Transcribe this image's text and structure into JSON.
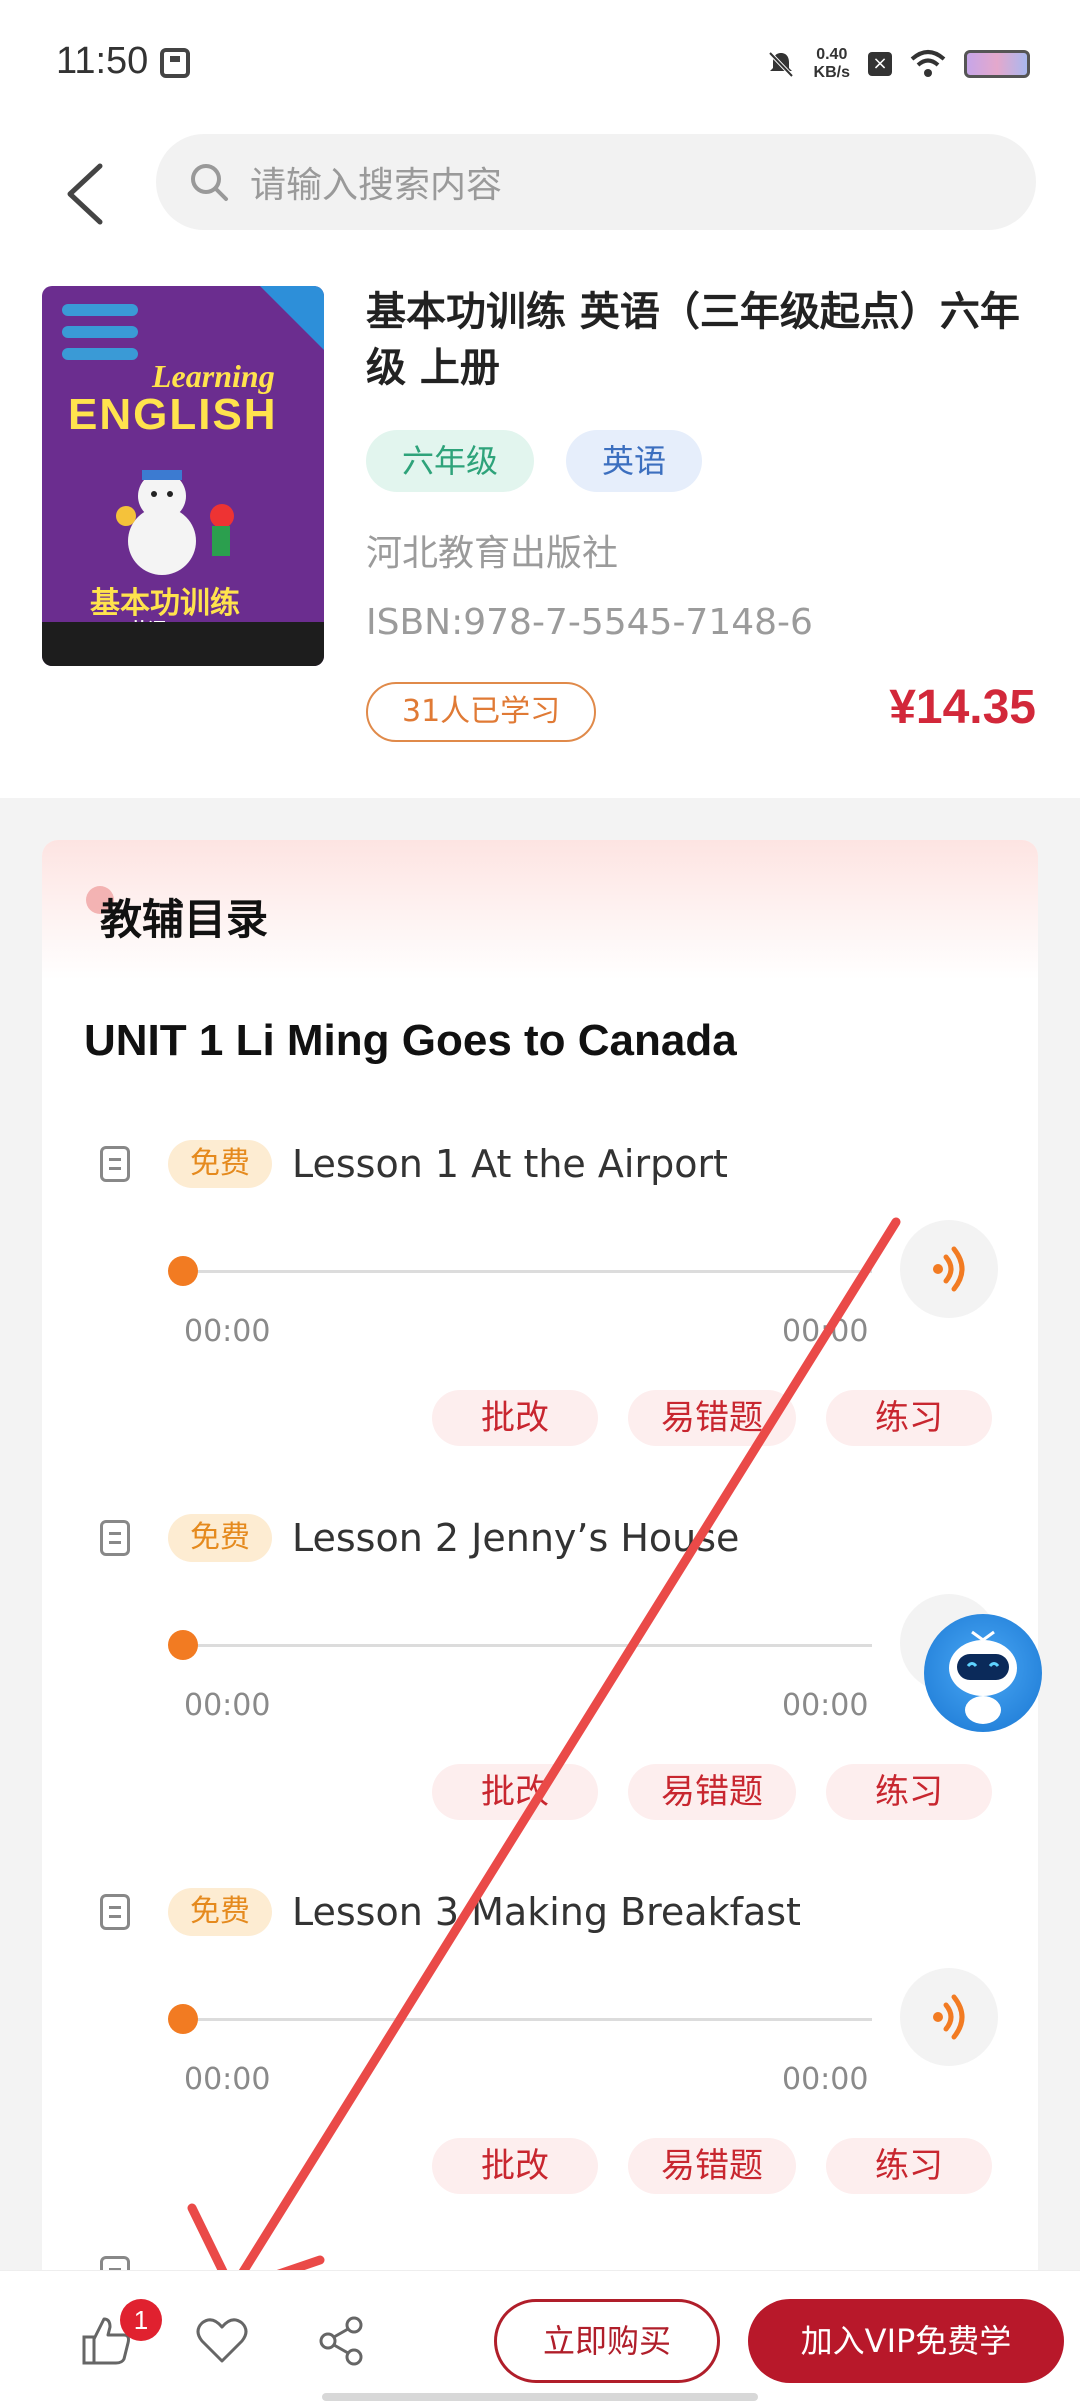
{
  "status_bar": {
    "time": "11:50",
    "net_speed_value": "0.40",
    "net_speed_unit": "KB/s"
  },
  "header": {
    "search_placeholder": "请输入搜索内容"
  },
  "book": {
    "title": "基本功训练 英语（三年级起点）六年级 上册",
    "tags": [
      "六年级",
      "英语"
    ],
    "publisher": "河北教育出版社",
    "isbn": "ISBN:978-7-5545-7148-6",
    "learners": "31人已学习",
    "price": "¥14.35",
    "cover": {
      "learning": "Learning",
      "english": "ENGLISH",
      "title": "基本功训练",
      "subject": "英语"
    }
  },
  "catalog": {
    "title": "教辅目录",
    "unit_title": "UNIT 1 Li Ming Goes to Canada",
    "free_label": "免费",
    "lessons": [
      {
        "title": "Lesson 1 At the Airport",
        "time_start": "00:00",
        "time_end": "00:00",
        "progress": 0
      },
      {
        "title": "Lesson 2 Jenny’s House",
        "time_start": "00:00",
        "time_end": "00:00",
        "progress": 0
      },
      {
        "title": "Lesson 3 Making Breakfast",
        "time_start": "00:00",
        "time_end": "00:00",
        "progress": 0
      }
    ],
    "buttons": {
      "correct": "批改",
      "mistakes": "易错题",
      "practice": "练习"
    }
  },
  "bottom_bar": {
    "like_count": "1",
    "buy_label": "立即购买",
    "vip_label": "加入VIP免费学"
  },
  "colors": {
    "brand_red": "#b8182a",
    "price_red": "#d2283a",
    "accent_orange": "#f27b22",
    "annotation_arrow": "#ea4a48"
  }
}
